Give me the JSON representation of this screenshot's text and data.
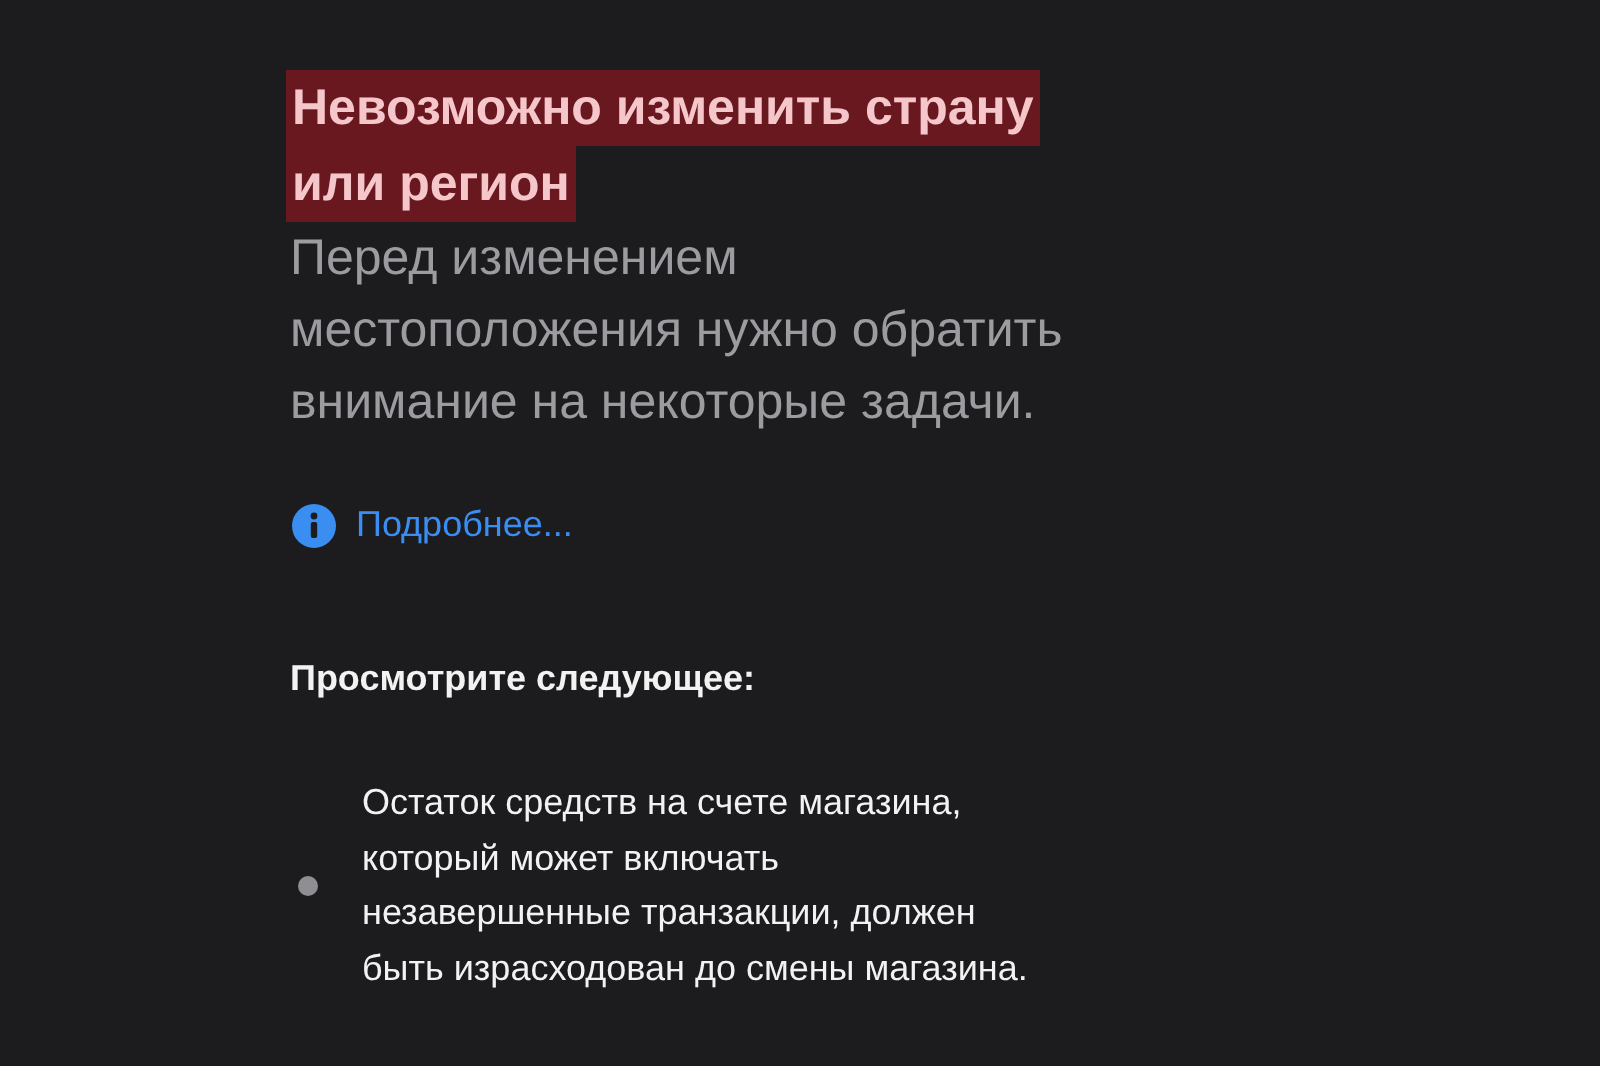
{
  "title": {
    "lines": [
      "Невозможно изменить страну",
      "или регион"
    ],
    "highlighted": true
  },
  "subtitle": {
    "lines": [
      "Перед изменением",
      "местоположения нужно обратить",
      "внимание на некоторые задачи."
    ]
  },
  "info_link": "Подробнее...",
  "section_heading": "Просмотрите следующее:",
  "items": [
    {
      "lines": [
        "Остаток средств на счете магазина,",
        "который может включать",
        "незавершенные транзакции, должен",
        "быть израсходован до смены магазина."
      ]
    }
  ]
}
